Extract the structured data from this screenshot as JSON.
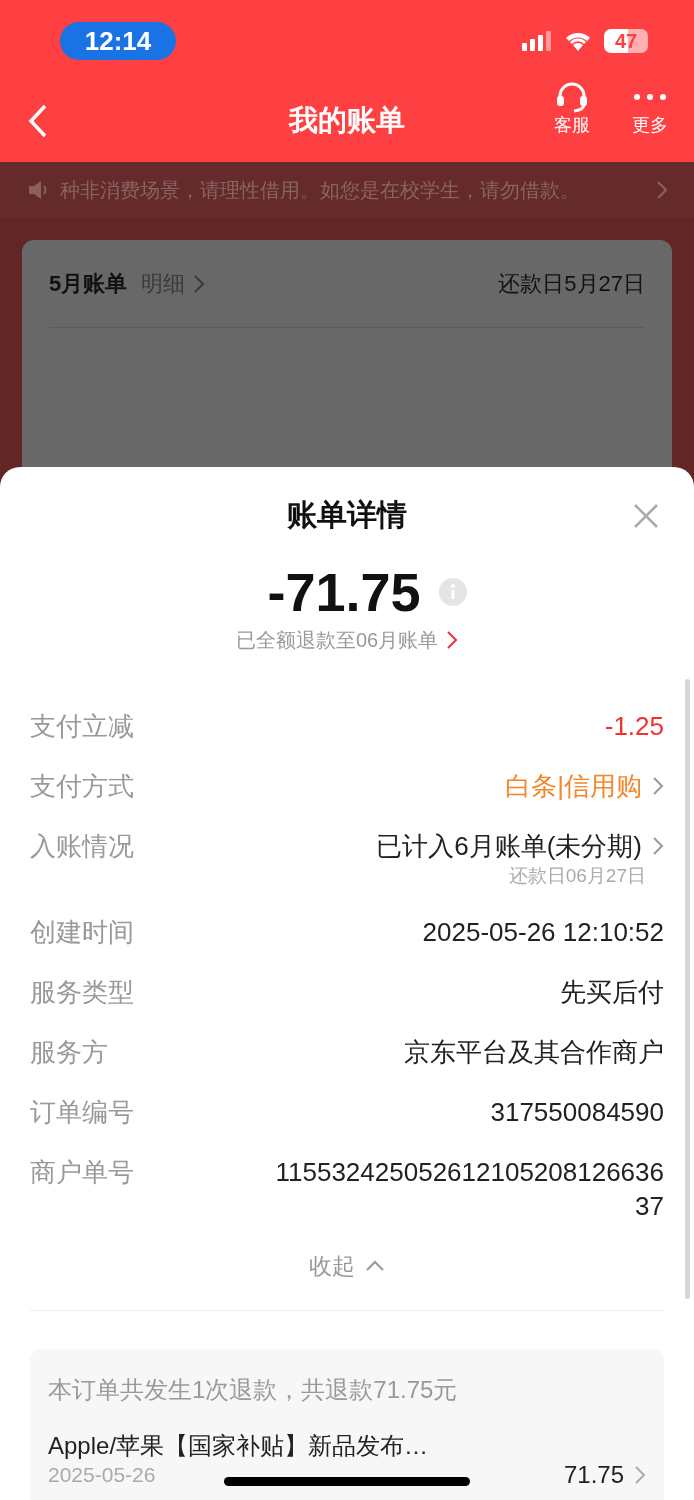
{
  "status_bar": {
    "time": "12:14",
    "battery": "47"
  },
  "nav": {
    "title": "我的账单",
    "actions": [
      {
        "kind": "service",
        "label": "客服"
      },
      {
        "kind": "more",
        "label": "更多"
      }
    ]
  },
  "notice": {
    "text": "种非消费场景，请理性借用。如您是在校学生，请勿借款。"
  },
  "bill_card": {
    "month": "5月账单",
    "detail_link": "明细",
    "due_date": "还款日5月27日"
  },
  "sheet": {
    "title": "账单详情",
    "amount": "-71.75",
    "refund_note": "已全额退款至06月账单",
    "rows": [
      {
        "label": "支付立减",
        "value": "-1.25",
        "kind": "discount",
        "chevron": false
      },
      {
        "label": "支付方式",
        "value": "白条|信用购",
        "kind": "payment",
        "chevron": true
      },
      {
        "label": "入账情况",
        "value": "已计入6月账单(未分期)",
        "kind": "plain",
        "chevron": true,
        "note": "还款日06月27日"
      },
      {
        "label": "创建时间",
        "value": "2025-05-26 12:10:52",
        "kind": "plain",
        "chevron": false
      },
      {
        "label": "服务类型",
        "value": "先买后付",
        "kind": "plain",
        "chevron": false
      },
      {
        "label": "服务方",
        "value": "京东平台及其合作商户",
        "kind": "plain",
        "chevron": false
      },
      {
        "label": "订单编号",
        "value": "317550084590",
        "kind": "plain",
        "chevron": false
      },
      {
        "label": "商户单号",
        "value": "11553242505261210520812663637",
        "kind": "plain",
        "chevron": false
      }
    ],
    "collapse": "收起",
    "refunds": {
      "summary": "本订单共发生1次退款，共退款71.75元",
      "items": [
        {
          "name": "Apple/苹果【国家补贴】新品发布…",
          "date": "2025-05-26",
          "amount": "71.75"
        }
      ]
    }
  }
}
